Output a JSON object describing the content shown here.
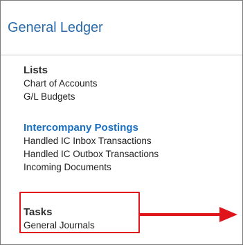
{
  "page": {
    "title": "General Ledger"
  },
  "groups": [
    {
      "title": "Lists",
      "items": [
        "Chart of Accounts",
        "G/L Budgets"
      ]
    },
    {
      "title": "Intercompany Postings",
      "items": [
        "Handled IC Inbox Transactions",
        "Handled IC Outbox Transactions",
        "Incoming Documents"
      ]
    },
    {
      "title": "Tasks",
      "items": [
        "General Journals"
      ]
    }
  ],
  "annotations": {
    "highlight_color": "#e0141b",
    "title_color": "#2b6aa8",
    "group_accent_color": "#1a6fc0"
  }
}
